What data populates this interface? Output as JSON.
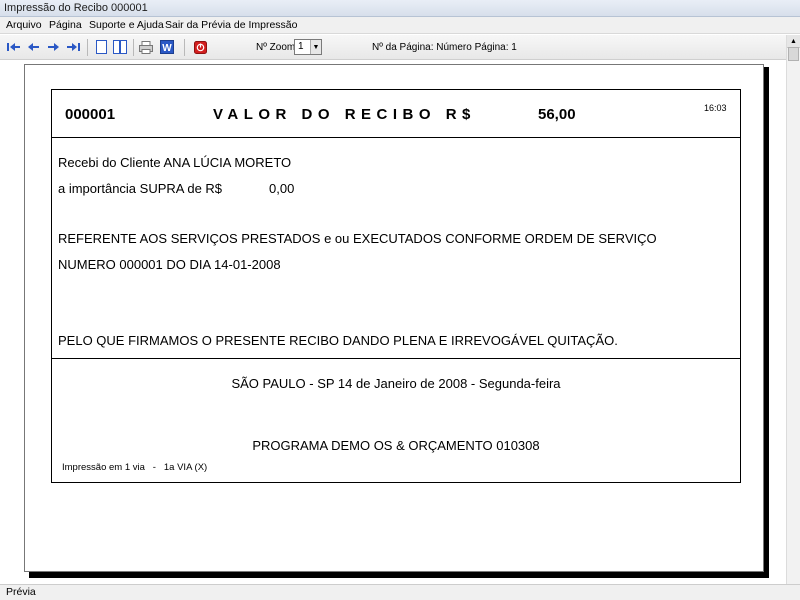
{
  "window": {
    "title": "Impressão do Recibo 000001"
  },
  "menu": {
    "items": [
      "Arquivo",
      "Página",
      "Suporte e Ajuda",
      "Sair da Prévia de Impressão"
    ]
  },
  "toolbar": {
    "icons": [
      "first-page-icon",
      "prev-page-icon",
      "next-page-icon",
      "last-page-icon",
      "single-page-icon",
      "two-pages-icon",
      "print-icon",
      "word-export-icon",
      "close-preview-icon"
    ],
    "zoom_label": "Nº Zoom",
    "zoom_value": "1",
    "page_info": "Nº da Página: Número Página: 1"
  },
  "receipt": {
    "number": "000001",
    "title": "VALOR DO RECIBO R$",
    "value": "56,00",
    "time": "16:03",
    "client_line": "Recebi do Cliente  ANA LÚCIA MORETO",
    "amount_line": "a importância SUPRA de R$",
    "amount_value": "0,00",
    "reference_line1": "REFERENTE AOS SERVIÇOS PRESTADOS e ou EXECUTADOS CONFORME ORDEM DE SERVIÇO",
    "reference_line2": "NUMERO 000001 DO DIA 14-01-2008",
    "quitation_line": "PELO QUE FIRMAMOS O PRESENTE RECIBO DANDO PLENA E IRREVOGÁVEL QUITAÇÃO.",
    "place_date": "SÃO PAULO - SP 14 de Janeiro de 2008 - Segunda-feira",
    "program": "PROGRAMA DEMO OS & ORÇAMENTO 010308",
    "copy_info": "Impressão em 1 via   -   1a VIA (X)"
  },
  "statusbar": {
    "text": "Prévia"
  },
  "colors": {
    "accent": "#2a58c5",
    "close_icon": "#d21f1f"
  }
}
